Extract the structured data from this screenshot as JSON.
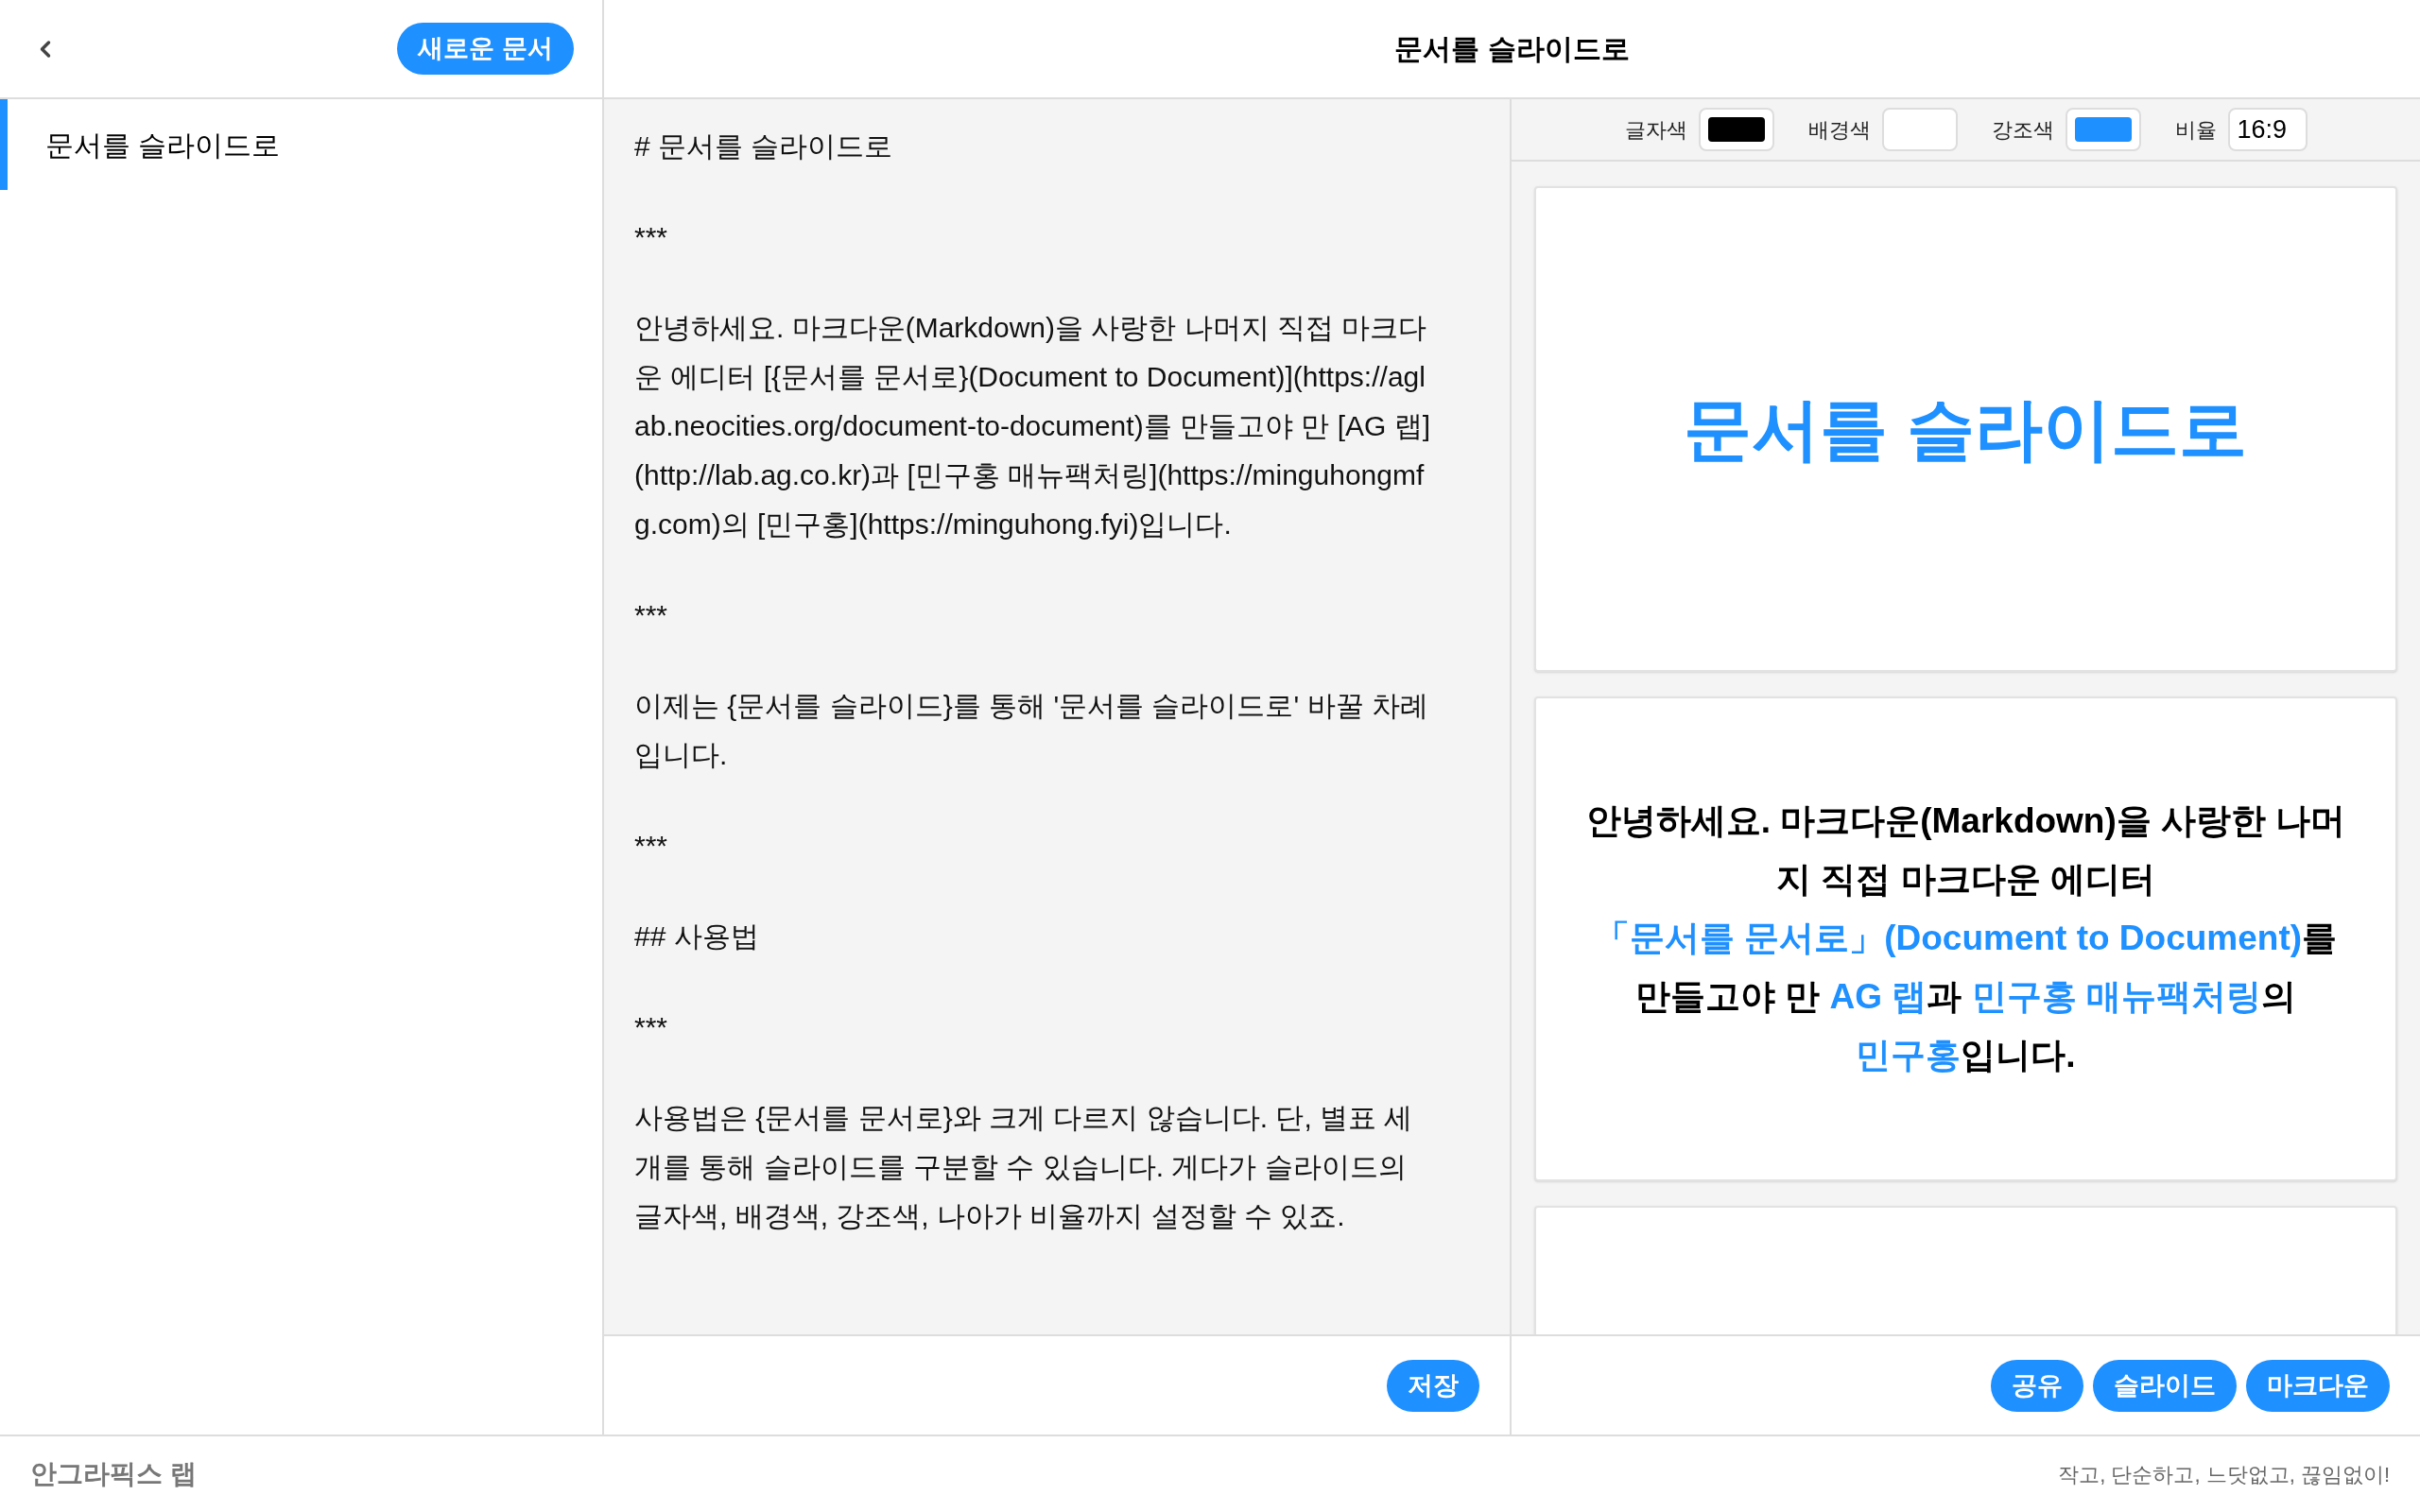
{
  "sidebar": {
    "new_button": "새로운 문서",
    "documents": [
      {
        "title": "문서를 슬라이드로",
        "selected": true
      }
    ]
  },
  "header": {
    "title": "문서를 슬라이드로"
  },
  "editor": {
    "blocks": [
      "# 문서를 슬라이드로",
      "***",
      "안녕하세요. 마크다운(Markdown)을 사랑한 나머지 직접 마크다운 에디터 [{문서를 문서로}(Document to Document)](https://aglab.neocities.org/document-to-document)를 만들고야 만 [AG 랩](http://lab.ag.co.kr)과 [민구홍 매뉴팩처링](https://minguhongmfg.com)의 [민구홍](https://minguhong.fyi)입니다.",
      "***",
      "이제는 {문서를 슬라이드}를 통해 '문서를 슬라이드로' 바꿀 차례입니다.",
      "***",
      "## 사용법",
      "***",
      "사용법은 {문서를 문서로}와 크게 다르지 않습니다. 단, 별표 세 개를 통해 슬라이드를 구분할 수 있습니다. 게다가 슬라이드의 글자색, 배경색, 강조색, 나아가 비율까지 설정할 수 있죠."
    ],
    "save_button": "저장"
  },
  "settings": {
    "text_color": {
      "label": "글자색",
      "color": "#000000"
    },
    "background_color": {
      "label": "배경색",
      "color": "#ffffff"
    },
    "accent_color": {
      "label": "강조색",
      "color": "#1e90ff"
    },
    "ratio": {
      "label": "비율",
      "value": "16:9"
    }
  },
  "slides": [
    {
      "kind": "title",
      "text": "문서를 슬라이드로"
    },
    {
      "kind": "paragraph",
      "segments": [
        {
          "text": "안녕하세요. 마크다운(Markdown)을 사랑한 나머지 직접 마크다운 에디터 ",
          "link": false
        },
        {
          "text": "「문서를 문서로」(Document to Document)",
          "link": true
        },
        {
          "text": "를 만들고야 만 ",
          "link": false
        },
        {
          "text": "AG 랩",
          "link": true
        },
        {
          "text": "과 ",
          "link": false
        },
        {
          "text": "민구홍 매뉴팩처링",
          "link": true
        },
        {
          "text": "의 ",
          "link": false
        },
        {
          "text": "민구홍",
          "link": true
        },
        {
          "text": "입니다.",
          "link": false
        }
      ]
    },
    {
      "kind": "blank"
    }
  ],
  "preview_buttons": [
    "공유",
    "슬라이드",
    "마크다운"
  ],
  "footer": {
    "logo": "안그라픽스 랩",
    "tagline": "작고, 단순하고, 느닷없고, 끊임없이!"
  }
}
